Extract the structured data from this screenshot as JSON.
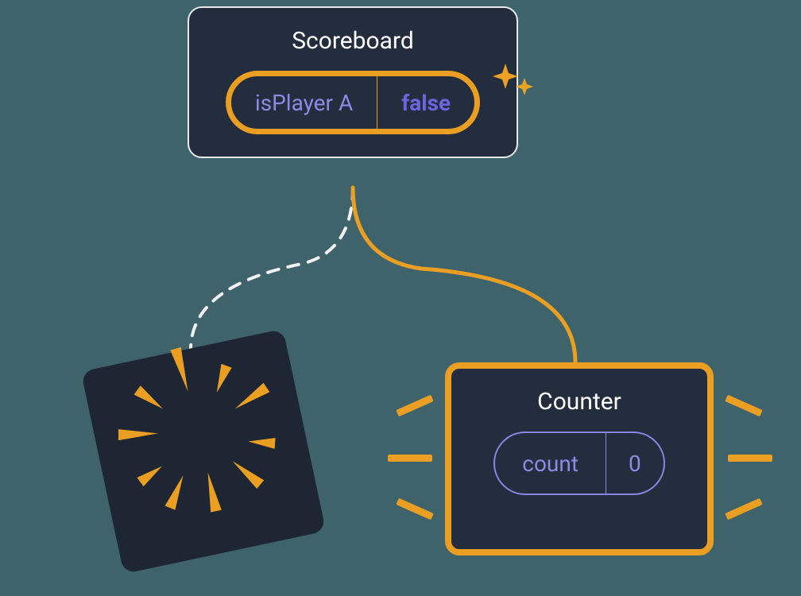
{
  "scoreboard": {
    "title": "Scoreboard",
    "state_key": "isPlayer A",
    "state_value": "false"
  },
  "counter": {
    "title": "Counter",
    "state_key": "count",
    "state_value": "0"
  },
  "colors": {
    "accent": "#eb9f22",
    "card_bg": "#242d3d",
    "text_purple": "#8b8be6"
  }
}
